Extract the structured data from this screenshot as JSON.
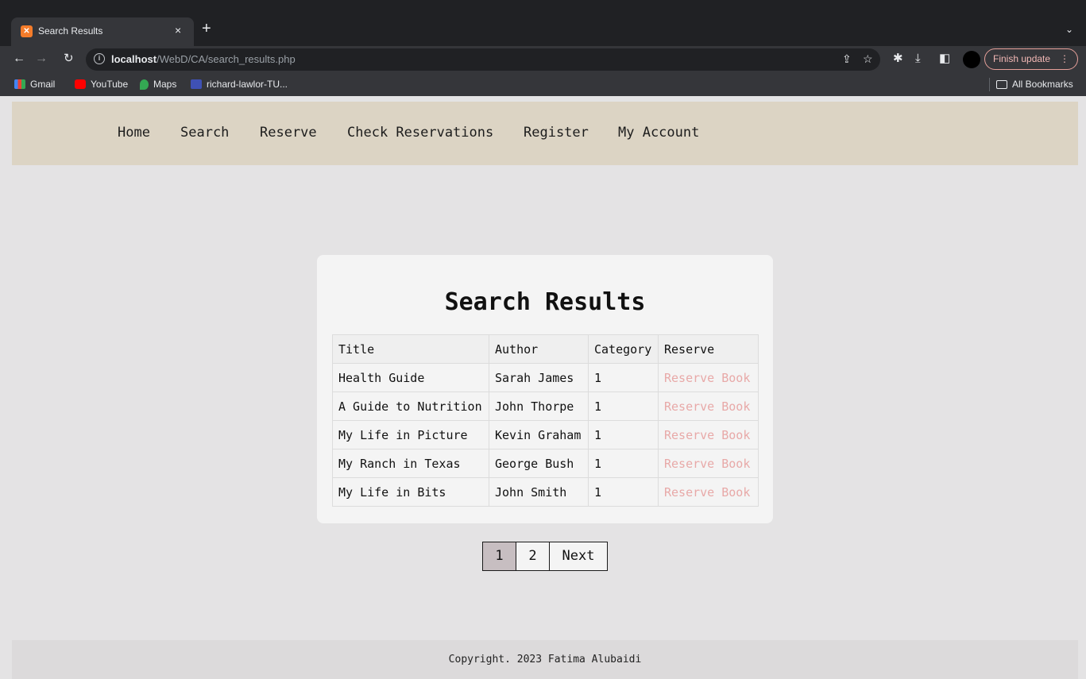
{
  "browser": {
    "tab": {
      "title": "Search Results",
      "close_glyph": "×"
    },
    "new_tab_glyph": "+",
    "url_host": "localhost",
    "url_path": "/WebD/CA/search_results.php",
    "finish_update_label": "Finish update",
    "bookmarks": [
      {
        "label": "Gmail",
        "icon": "gmail-icon"
      },
      {
        "label": "YouTube",
        "icon": "youtube-icon"
      },
      {
        "label": "Maps",
        "icon": "maps-icon"
      },
      {
        "label": "richard-lawlor-TU...",
        "icon": "bookmark-icon"
      }
    ],
    "all_bookmarks_label": "All Bookmarks"
  },
  "site": {
    "nav": [
      {
        "label": "Home"
      },
      {
        "label": "Search"
      },
      {
        "label": "Reserve"
      },
      {
        "label": "Check Reservations"
      },
      {
        "label": "Register"
      },
      {
        "label": "My Account"
      }
    ],
    "results": {
      "heading": "Search Results",
      "columns": [
        "Title",
        "Author",
        "Category",
        "Reserve"
      ],
      "rows": [
        {
          "title": "Health Guide",
          "author": "Sarah James",
          "category": "1",
          "action": "Reserve Book"
        },
        {
          "title": "A Guide to Nutrition",
          "author": "John Thorpe",
          "category": "1",
          "action": "Reserve Book"
        },
        {
          "title": "My Life in Picture",
          "author": "Kevin Graham",
          "category": "1",
          "action": "Reserve Book"
        },
        {
          "title": "My Ranch in Texas",
          "author": "George Bush",
          "category": "1",
          "action": "Reserve Book"
        },
        {
          "title": "My Life in Bits",
          "author": "John Smith",
          "category": "1",
          "action": "Reserve Book"
        }
      ]
    },
    "pagination": {
      "pages": [
        "1",
        "2"
      ],
      "current": "1",
      "next_label": "Next"
    },
    "footer": "Copyright. 2023 Fatima Alubaidi"
  },
  "colors": {
    "nav_bg": "#dcd4c4",
    "page_bg": "#e4e3e4",
    "reserve_link": "#e8a9a8",
    "active_page": "#c7bec1"
  }
}
